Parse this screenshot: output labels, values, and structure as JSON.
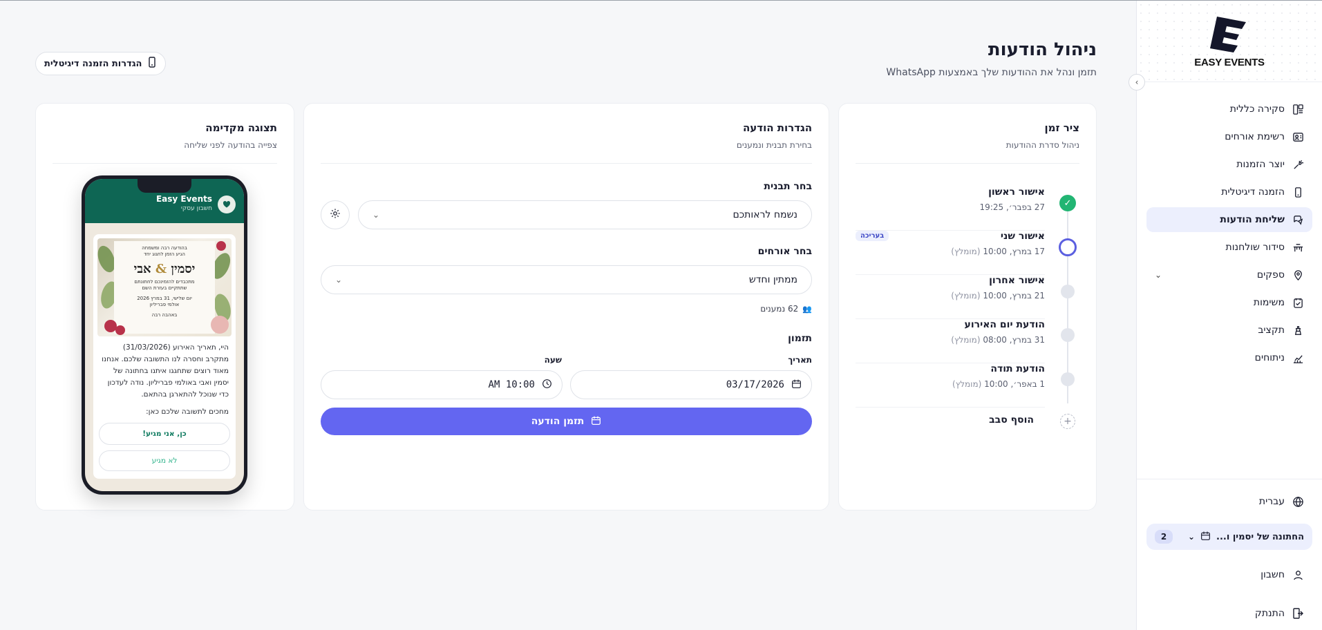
{
  "brand": {
    "name": "EASY EVENTS",
    "accent": "#6366f1",
    "success": "#22b573",
    "whatsapp_green": "#0e6654"
  },
  "sidebar": {
    "items": [
      {
        "label": "סקירה כללית",
        "icon": "dashboard-icon",
        "active": false
      },
      {
        "label": "רשימת אורחים",
        "icon": "guests-icon",
        "active": false
      },
      {
        "label": "יוצר הזמנות",
        "icon": "invitation-creator-icon",
        "active": false
      },
      {
        "label": "הזמנה דיגיטלית",
        "icon": "phone-icon",
        "active": false
      },
      {
        "label": "שליחת הודעות",
        "icon": "messages-icon",
        "active": true
      },
      {
        "label": "סידור שולחנות",
        "icon": "tables-icon",
        "active": false
      },
      {
        "label": "ספקים",
        "icon": "location-pin-icon",
        "active": false
      },
      {
        "label": "משימות",
        "icon": "tasks-icon",
        "active": false
      },
      {
        "label": "תקציב",
        "icon": "budget-icon",
        "active": false
      },
      {
        "label": "ניתוחים",
        "icon": "analytics-icon",
        "active": false
      }
    ],
    "language_label": "עברית",
    "event_selector": {
      "label": "החתונה של יסמין ו...",
      "count": "2"
    },
    "account_label": "חשבון",
    "logout_label": "התנתק"
  },
  "header": {
    "title": "ניהול הודעות",
    "subtitle": "תזמן ונהל את ההודעות שלך באמצעות WhatsApp",
    "digital_settings_label": "הגדרות הזמנה דיגיטלית"
  },
  "timeline": {
    "title": "ציר זמן",
    "subtitle": "ניהול סדרת ההודעות",
    "items": [
      {
        "title": "אישור ראשון",
        "date": "27 בפבר׳, 19:25",
        "rec": "",
        "badge": "",
        "status": "done"
      },
      {
        "title": "אישור שני",
        "date": "17 במרץ, 10:00",
        "rec": "(מומלץ)",
        "badge": "בעריכה",
        "status": "current"
      },
      {
        "title": "אישור אחרון",
        "date": "21 במרץ, 10:00",
        "rec": "(מומלץ)",
        "badge": "",
        "status": "pending"
      },
      {
        "title": "הודעת יום האירוע",
        "date": "31 במרץ, 08:00",
        "rec": "(מומלץ)",
        "badge": "",
        "status": "pending"
      },
      {
        "title": "הודעת תודה",
        "date": "1 באפר׳, 10:00",
        "rec": "(מומלץ)",
        "badge": "",
        "status": "pending"
      }
    ],
    "add_label": "הוסף סבב"
  },
  "settings": {
    "title": "הגדרות הודעה",
    "subtitle": "בחירת תבנית ונמענים",
    "template_label": "בחר תבנית",
    "template_value": "נשמח לראותכם",
    "guests_label": "בחר אורחים",
    "guests_value": "ממתין וחדש",
    "recipients": "62 נמענים",
    "timing_label": "תזמון",
    "date_label": "תאריך",
    "date_value": "03/17/2026",
    "time_label": "שעה",
    "time_value": "10:00 AM",
    "schedule_label": "תזמן הודעה"
  },
  "preview": {
    "title": "תצוגה מקדימה",
    "subtitle": "צפייה בהודעה לפני שליחה",
    "wa_name": "Easy Events",
    "wa_business": "חשבון עסקי",
    "invite": {
      "line1": "בהודעה רבה ומשמחה",
      "line2": "הגיע הזמן לחגוג יחד",
      "name_a": "יסמין",
      "amp": "&",
      "name_b": "אבי",
      "line3": "מתכבדים להזמינכם לחתונתם",
      "line4": "שתתקיים בעזרת השם",
      "line5": "יום שלישי, 31 במרץ 2026",
      "line6": "אולמי פבריליון",
      "line7": "באהבה רבה"
    },
    "message": "היי, תאריך האירוע (31/03/2026) מתקרב וחסרה לנו התשובה שלכם. אנחנו מאוד רוצים שתחגגו איתנו בחתונה של יסמין ואבי באולמי פבריליון. נודה לעדכון כדי שנוכל להתארגן בהתאם.",
    "waiting": "מחכים לתשובה שלכם כאן:",
    "yes_label": "כן, אני מגיע!",
    "no_label": "לא מגיע"
  }
}
